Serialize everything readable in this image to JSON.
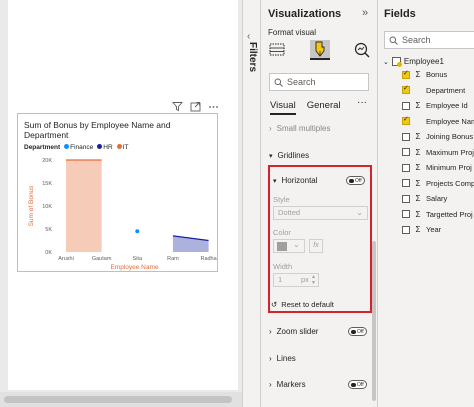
{
  "visual": {
    "title": "Sum of Bonus by Employee Name and Department",
    "legend": {
      "title": "Department",
      "items": [
        {
          "label": "Finance",
          "color": "#118DFF"
        },
        {
          "label": "HR",
          "color": "#12239E"
        },
        {
          "label": "IT",
          "color": "#E66C37"
        }
      ]
    },
    "header_icons": [
      "filter-icon",
      "focus-mode-icon",
      "more-options-icon"
    ]
  },
  "chart_data": {
    "type": "area",
    "title": "Sum of Bonus by Employee Name and Department",
    "xlabel": "Employee Name",
    "ylabel": "Sum of Bonus",
    "categories": [
      "Arushi",
      "Gautam",
      "Sita",
      "Ram",
      "Radha"
    ],
    "y_ticks": [
      "0K",
      "5K",
      "10K",
      "15K",
      "20K"
    ],
    "ylim": [
      0,
      20000
    ],
    "legend_position": "top-left",
    "series": [
      {
        "name": "Finance",
        "color": "#118DFF",
        "values": [
          null,
          null,
          4500,
          null,
          null
        ]
      },
      {
        "name": "HR",
        "color": "#12239E",
        "values": [
          null,
          null,
          null,
          3500,
          2500
        ]
      },
      {
        "name": "IT",
        "color": "#E66C37",
        "values": [
          20000,
          20000,
          null,
          null,
          null
        ]
      }
    ]
  },
  "filters_pane": {
    "label": "Filters"
  },
  "visualizations": {
    "title": "Visualizations",
    "format_label": "Format visual",
    "search_placeholder": "Search",
    "tabs": [
      "Visual",
      "General"
    ],
    "small_multiples": "Small multiples",
    "gridlines": "Gridlines",
    "horizontal": {
      "label": "Horizontal",
      "toggle": "Off",
      "style_label": "Style",
      "style_value": "Dotted",
      "color_label": "Color",
      "fx": "fx",
      "width_label": "Width",
      "width_value": "1",
      "width_unit": "px",
      "reset": "Reset to default"
    },
    "zoom_slider": {
      "label": "Zoom slider",
      "toggle": "Off"
    },
    "lines": "Lines",
    "markers": {
      "label": "Markers",
      "toggle": "Off"
    }
  },
  "fields": {
    "title": "Fields",
    "search_placeholder": "Search",
    "table": "Employee1",
    "items": [
      {
        "label": "Bonus",
        "checked": true,
        "sigma": true
      },
      {
        "label": "Department",
        "checked": true,
        "sigma": false
      },
      {
        "label": "Employee Id",
        "checked": false,
        "sigma": true
      },
      {
        "label": "Employee Nam",
        "checked": true,
        "sigma": false
      },
      {
        "label": "Joining Bonus",
        "checked": false,
        "sigma": true
      },
      {
        "label": "Maximum Proj",
        "checked": false,
        "sigma": true
      },
      {
        "label": "Minimum Proj",
        "checked": false,
        "sigma": true
      },
      {
        "label": "Projects Comp",
        "checked": false,
        "sigma": true
      },
      {
        "label": "Salary",
        "checked": false,
        "sigma": true
      },
      {
        "label": "Targetted Proj",
        "checked": false,
        "sigma": true
      },
      {
        "label": "Year",
        "checked": false,
        "sigma": true
      }
    ]
  }
}
